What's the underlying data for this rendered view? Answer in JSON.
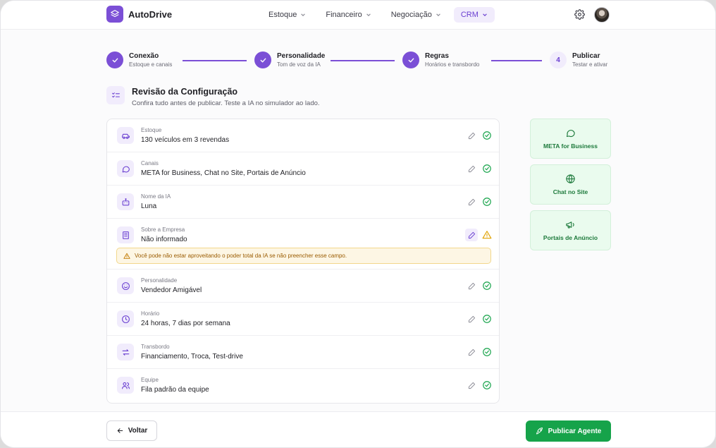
{
  "app": {
    "name": "AutoDrive"
  },
  "nav": {
    "items": [
      {
        "label": "Estoque"
      },
      {
        "label": "Financeiro"
      },
      {
        "label": "Negociação"
      },
      {
        "label": "CRM"
      }
    ],
    "active": "CRM"
  },
  "stepper": {
    "steps": [
      {
        "title": "Conexão",
        "subtitle": "Estoque e canais",
        "status": "done"
      },
      {
        "title": "Personalidade",
        "subtitle": "Tom de voz da IA",
        "status": "done"
      },
      {
        "title": "Regras",
        "subtitle": "Horários e transbordo",
        "status": "done"
      },
      {
        "title": "Publicar",
        "subtitle": "Testar e ativar",
        "status": "current",
        "number": "4"
      }
    ]
  },
  "review": {
    "title": "Revisão da Configuração",
    "subtitle": "Confira tudo antes de publicar. Teste a IA no simulador ao lado."
  },
  "config": {
    "rows": [
      {
        "label": "Estoque",
        "value": "130 veículos em 3 revendas",
        "icon": "car-icon",
        "status": "ok"
      },
      {
        "label": "Canais",
        "value": "META for Business, Chat no Site, Portais de Anúncio",
        "icon": "chat-bubble-icon",
        "status": "ok"
      },
      {
        "label": "Nome da IA",
        "value": "Luna",
        "icon": "bot-icon",
        "status": "ok"
      },
      {
        "label": "Sobre a Empresa",
        "value": "Não informado",
        "icon": "building-icon",
        "status": "warning",
        "warning": "Você pode não estar aproveitando o poder total da IA se não preencher esse campo."
      },
      {
        "label": "Personalidade",
        "value": "Vendedor Amigável",
        "icon": "smile-icon",
        "status": "ok"
      },
      {
        "label": "Horário",
        "value": "24 horas, 7 dias por semana",
        "icon": "clock-icon",
        "status": "ok"
      },
      {
        "label": "Transbordo",
        "value": "Financiamento, Troca, Test-drive",
        "icon": "transfer-icon",
        "status": "ok"
      },
      {
        "label": "Equipe",
        "value": "Fila padrão da equipe",
        "icon": "team-icon",
        "status": "ok"
      }
    ]
  },
  "channels": [
    {
      "label": "META for Business",
      "icon": "message-circle-icon"
    },
    {
      "label": "Chat no Site",
      "icon": "globe-icon"
    },
    {
      "label": "Portais de Anúncio",
      "icon": "megaphone-icon"
    }
  ],
  "footer": {
    "back_label": "Voltar",
    "publish_label": "Publicar Agente"
  },
  "colors": {
    "accent": "#7b4fd6",
    "success": "#16a34a",
    "warning": "#e0a100",
    "channel_bg": "#eafbee"
  }
}
